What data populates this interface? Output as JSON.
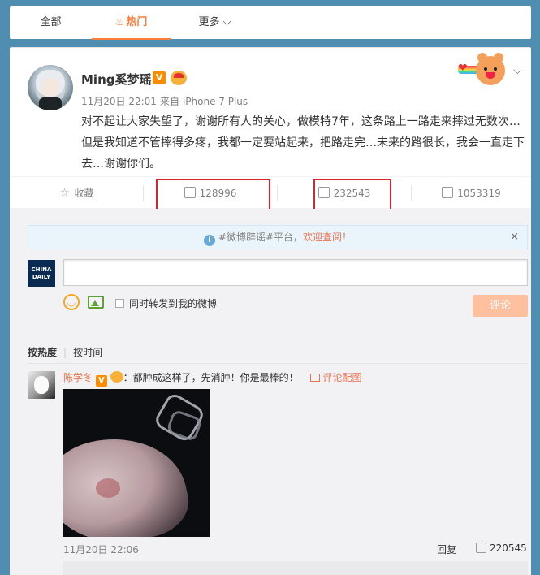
{
  "tabs": {
    "all": "全部",
    "hot": "热门",
    "more": "更多"
  },
  "post": {
    "username": "Ming奚梦瑶",
    "verified_mark": "V",
    "time": "11月20日 22:01",
    "source_prefix": "来自",
    "source": "iPhone 7 Plus",
    "content": "对不起让大家失望了，谢谢所有人的关心，做模特7年，这条路上一路走来摔过无数次…但是我知道不管摔得多疼，我都一定要站起来，把路走完…未来的路很长，我会一直走下去…谢谢你们。"
  },
  "actions": {
    "favorite": "收藏",
    "repost_count": "128996",
    "comment_count": "232543",
    "like_count": "1053319"
  },
  "notice": {
    "prefix": "#微博辟谣#平台，",
    "link": "欢迎查阅！",
    "close": "×"
  },
  "composer": {
    "logo_line1": "CHINA",
    "logo_line2": "DAILY",
    "also_repost_label": "同时转发到我的微博",
    "comment_button": "评论"
  },
  "sort": {
    "hot": "按热度",
    "time": "按时间"
  },
  "comment": {
    "username": "陈学冬",
    "verified_mark": "V",
    "text": "：都肿成这样了，先消肿！你是最棒的！",
    "pic_label": "评论配图",
    "time": "11月20日 22:06",
    "reply_label": "回复",
    "like_count": "220545"
  },
  "colors": {
    "accent": "#fa7d3c",
    "link": "#eb7350",
    "background": "#4f8eb1",
    "highlight_box": "#d8242a"
  }
}
